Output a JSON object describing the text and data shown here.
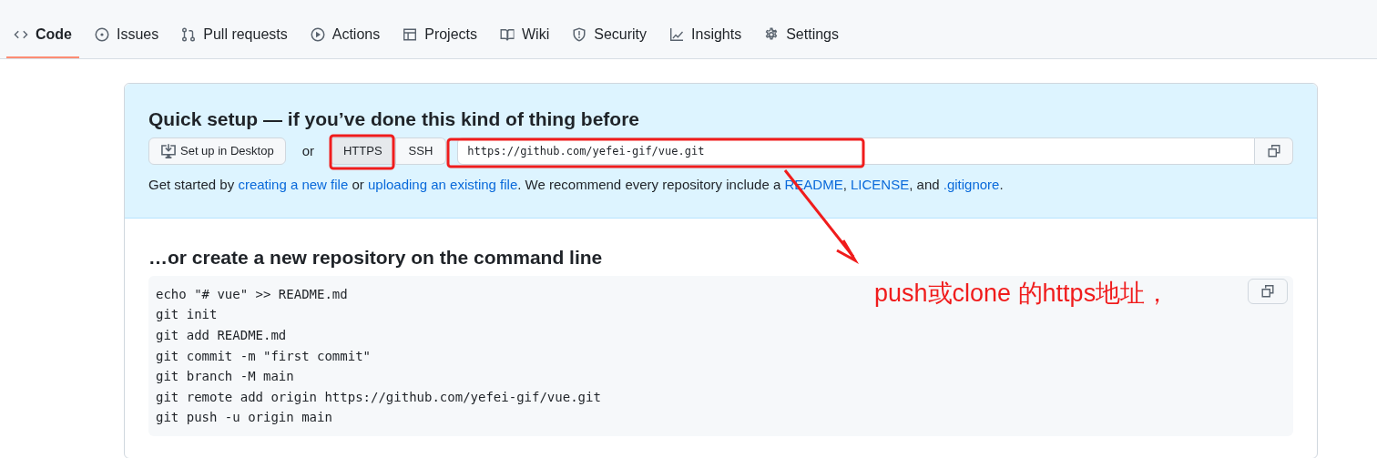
{
  "tabs": [
    {
      "label": "Code",
      "selected": true
    },
    {
      "label": "Issues",
      "selected": false
    },
    {
      "label": "Pull requests",
      "selected": false
    },
    {
      "label": "Actions",
      "selected": false
    },
    {
      "label": "Projects",
      "selected": false
    },
    {
      "label": "Wiki",
      "selected": false
    },
    {
      "label": "Security",
      "selected": false
    },
    {
      "label": "Insights",
      "selected": false
    },
    {
      "label": "Settings",
      "selected": false
    }
  ],
  "quick_setup": {
    "title": "Quick setup — if you’ve done this kind of thing before",
    "desktop_button": "Set up in Desktop",
    "or_label": "or",
    "protocols": [
      {
        "label": "HTTPS",
        "selected": true
      },
      {
        "label": "SSH",
        "selected": false
      }
    ],
    "clone_url": "https://github.com/yefei-gif/vue.git",
    "intro": [
      {
        "kind": "text",
        "text": "Get started by "
      },
      {
        "kind": "link",
        "text": "creating a new file"
      },
      {
        "kind": "text",
        "text": " or "
      },
      {
        "kind": "link",
        "text": "uploading an existing file"
      },
      {
        "kind": "text",
        "text": ". We recommend every repository include a "
      },
      {
        "kind": "link",
        "text": "README"
      },
      {
        "kind": "text",
        "text": ", "
      },
      {
        "kind": "link",
        "text": "LICENSE"
      },
      {
        "kind": "text",
        "text": ", and "
      },
      {
        "kind": "link",
        "text": ".gitignore"
      },
      {
        "kind": "text",
        "text": "."
      }
    ]
  },
  "command_line": {
    "title": "…or create a new repository on the command line",
    "lines": [
      "echo \"# vue\" >> README.md",
      "git init",
      "git add README.md",
      "git commit -m \"first commit\"",
      "git branch -M main",
      "git remote add origin https://github.com/yefei-gif/vue.git",
      "git push -u origin main"
    ]
  },
  "annotation": {
    "text": "push或clone 的https地址，"
  }
}
